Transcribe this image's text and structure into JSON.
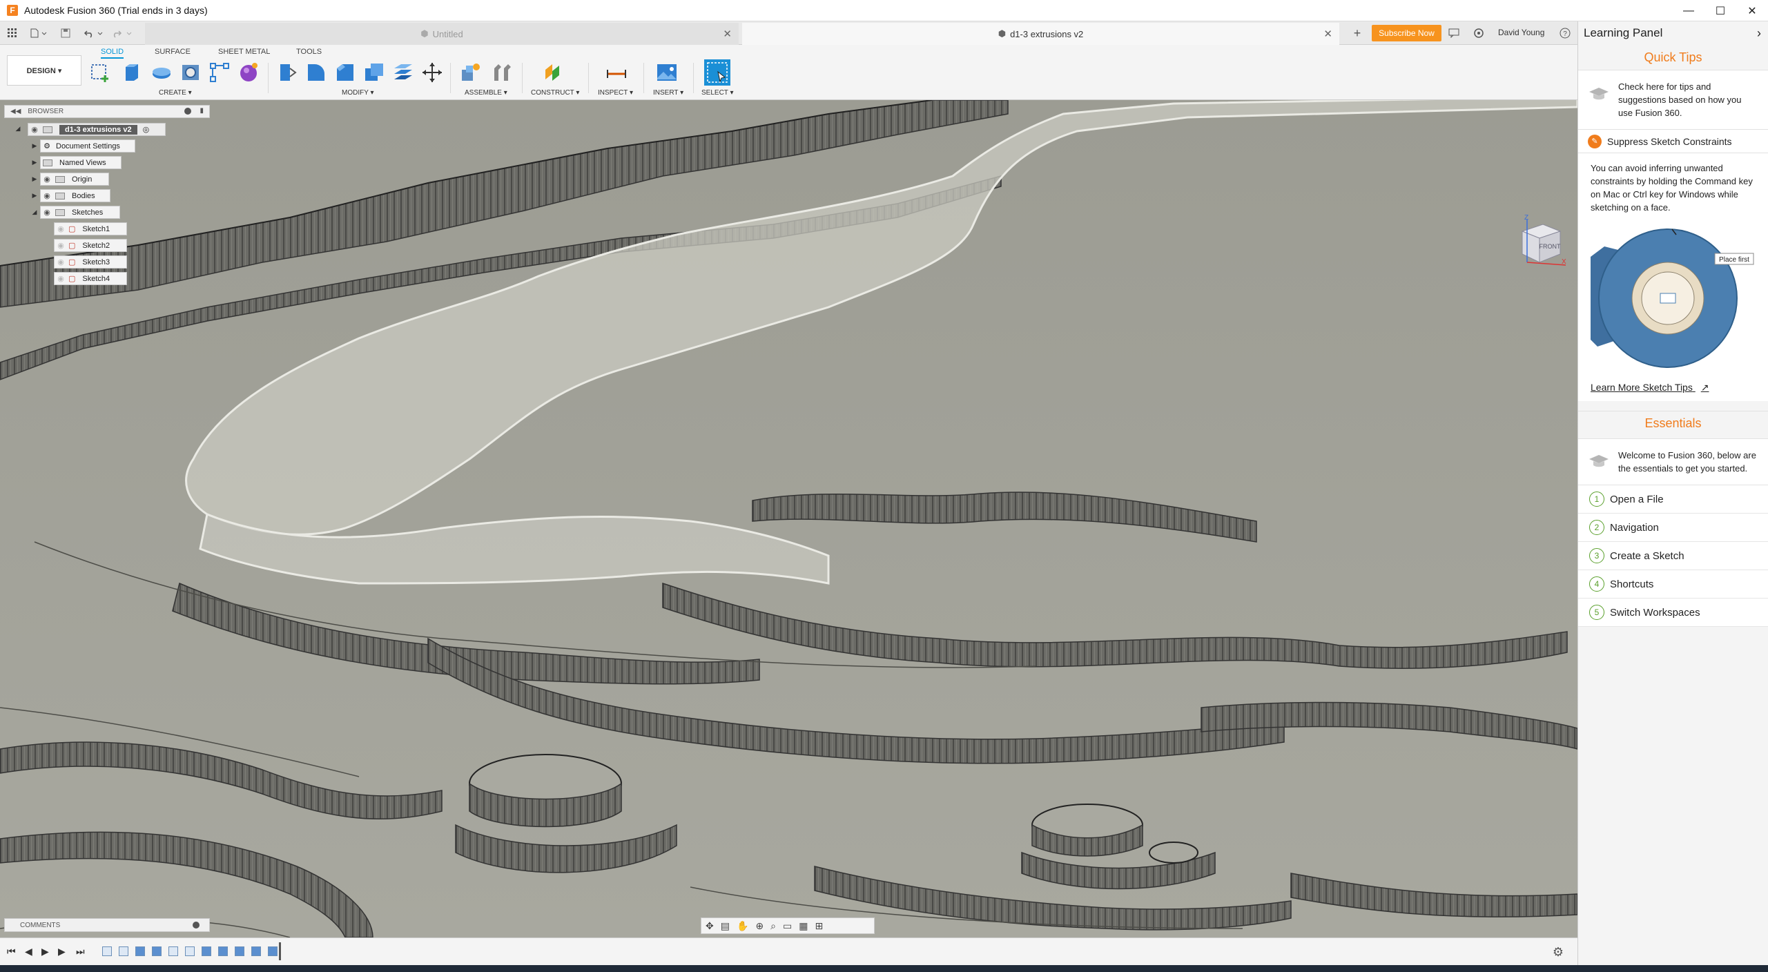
{
  "window": {
    "title": "Autodesk Fusion 360 (Trial ends in 3 days)",
    "app_icon_letter": "F",
    "minimize": "—",
    "maximize": "☐",
    "close": "✕"
  },
  "tabs": {
    "untitled": "Untitled",
    "active": "d1-3 extrusions v2",
    "close_glyph": "✕",
    "new_tab_glyph": "+"
  },
  "header_right": {
    "subscribe": "Subscribe Now",
    "user": "David Young"
  },
  "toolbar": {
    "workspace": "DESIGN ▾",
    "tabs": [
      "SOLID",
      "SURFACE",
      "SHEET METAL",
      "TOOLS"
    ],
    "groups": {
      "create": "CREATE ▾",
      "modify": "MODIFY ▾",
      "assemble": "ASSEMBLE ▾",
      "construct": "CONSTRUCT ▾",
      "inspect": "INSPECT ▾",
      "insert": "INSERT ▾",
      "select": "SELECT ▾"
    }
  },
  "browser": {
    "title": "BROWSER",
    "root": "d1-3 extrusions v2",
    "items": [
      "Document Settings",
      "Named Views",
      "Origin",
      "Bodies",
      "Sketches"
    ],
    "sketches": [
      "Sketch1",
      "Sketch2",
      "Sketch3",
      "Sketch4"
    ]
  },
  "comments": {
    "title": "COMMENTS"
  },
  "viewcube": {
    "face": "FRONT",
    "axis_z": "Z",
    "axis_x": "X"
  },
  "learning_panel": {
    "title": "Learning Panel",
    "quick_tips": {
      "heading": "Quick Tips",
      "intro": "Check here for tips and suggestions based on how you use Fusion 360.",
      "tip_title": "Suppress Sketch Constraints",
      "tip_body": "You can avoid inferring unwanted constraints by holding the Command key on Mac or Ctrl key for Windows while sketching on a face.",
      "image_callout": "Place first",
      "link": "Learn More Sketch Tips"
    },
    "essentials": {
      "heading": "Essentials",
      "intro": "Welcome to Fusion 360, below are the essentials to get you started.",
      "items": [
        {
          "num": "1",
          "label": "Open a File"
        },
        {
          "num": "2",
          "label": "Navigation"
        },
        {
          "num": "3",
          "label": "Create a Sketch"
        },
        {
          "num": "4",
          "label": "Shortcuts"
        },
        {
          "num": "5",
          "label": "Switch Workspaces"
        }
      ]
    }
  },
  "colors": {
    "accent_blue": "#0696d7",
    "subscribe_orange": "#f7931e",
    "learning_orange": "#f07c1c",
    "viewport_gray": "#a2a29a",
    "essentials_green": "#5aa02c"
  }
}
